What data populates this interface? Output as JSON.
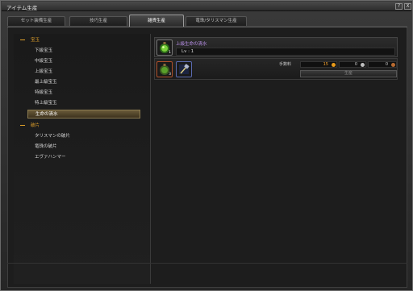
{
  "window": {
    "title": "アイテム生産",
    "help_label": "?",
    "close_label": "X"
  },
  "tabs": [
    {
      "label": "セット装備生産",
      "active": false
    },
    {
      "label": "技巧生産",
      "active": false
    },
    {
      "label": "雑貨生産",
      "active": true
    },
    {
      "label": "竜珠/タリスマン生産",
      "active": false
    }
  ],
  "tree": {
    "categories": [
      {
        "label": "宝玉",
        "items": [
          "下級宝玉",
          "中級宝玉",
          "上級宝玉",
          "最上級宝玉",
          "特級宝玉",
          "特上級宝玉",
          "生命の清水"
        ]
      },
      {
        "label": "破片",
        "items": [
          "タリスマンの破片",
          "竜珠の破片",
          "エヴァハンマー"
        ]
      }
    ],
    "selected": "生命の清水"
  },
  "recipe": {
    "name": "上級生命の清水",
    "level": "Lv : 1",
    "result_count": "1",
    "material_count": "3",
    "fee_label": "手数料",
    "gold": "15",
    "silver": "0",
    "copper": "0",
    "make_label": "生産"
  },
  "colors": {
    "accent": "#e0a02a",
    "recipe_name": "#b990e8",
    "gold_coin": "#e89a1a",
    "silver_coin": "#bfbfbf",
    "copper_coin": "#b86a30"
  }
}
